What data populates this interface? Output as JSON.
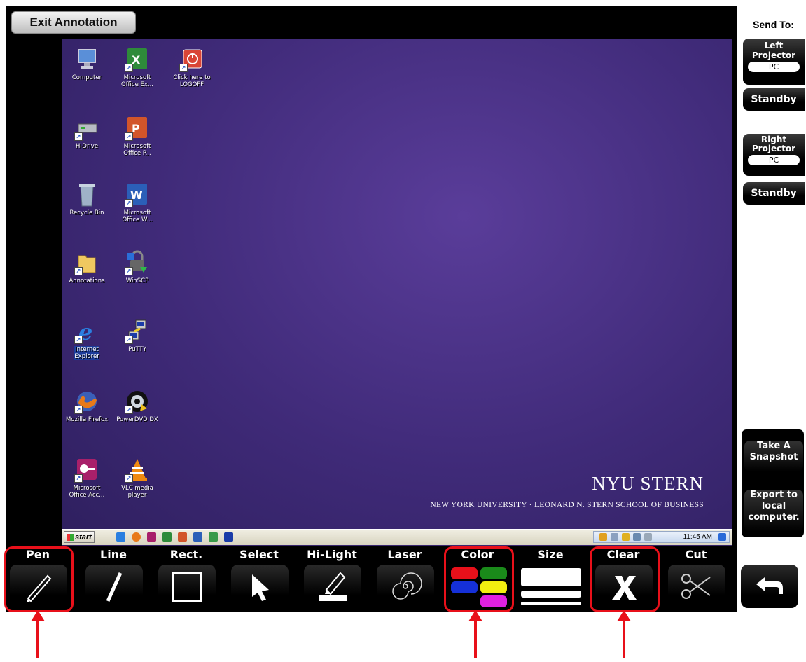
{
  "exit_label": "Exit Annotation",
  "desktop": {
    "icons": [
      {
        "label": "Computer"
      },
      {
        "label": "Microsoft\nOffice Ex..."
      },
      {
        "label": "Click here to\nLOGOFF"
      },
      {
        "label": "H-Drive"
      },
      {
        "label": "Microsoft\nOffice P..."
      },
      {
        "label": "Recycle Bin"
      },
      {
        "label": "Microsoft\nOffice W..."
      },
      {
        "label": "Annotations"
      },
      {
        "label": "WinSCP"
      },
      {
        "label": "Internet\nExplorer"
      },
      {
        "label": "PuTTY"
      },
      {
        "label": "Mozilla Firefox"
      },
      {
        "label": "PowerDVD DX"
      },
      {
        "label": "Microsoft\nOffice Acc..."
      },
      {
        "label": "VLC media\nplayer"
      }
    ],
    "brand_logo": "NYU STERN",
    "brand_sub": "NEW YORK UNIVERSITY · LEONARD N. STERN SCHOOL OF BUSINESS"
  },
  "taskbar": {
    "start_label": "start",
    "clock": "11:45 AM"
  },
  "send_panel": {
    "title": "Send To:",
    "left_projector": "Left\nProjector",
    "left_source": "PC",
    "left_standby": "Standby",
    "right_projector": "Right\nProjector",
    "right_source": "PC",
    "right_standby": "Standby"
  },
  "snapshot_label": "Take A\nSnapshot",
  "export_label": "Export to\nlocal\ncomputer.",
  "tools": {
    "pen": "Pen",
    "line": "Line",
    "rect": "Rect.",
    "select": "Select",
    "highlight": "Hi-Light",
    "laser": "Laser",
    "color": "Color",
    "size": "Size",
    "clear": "Clear",
    "cut": "Cut",
    "undo": "Undo"
  },
  "colors": {
    "red": "#e8101a",
    "green": "#1a8a1a",
    "blue": "#1530d8",
    "yellow": "#f2ee10",
    "magenta": "#e020e0",
    "accent": "#e8101a"
  }
}
